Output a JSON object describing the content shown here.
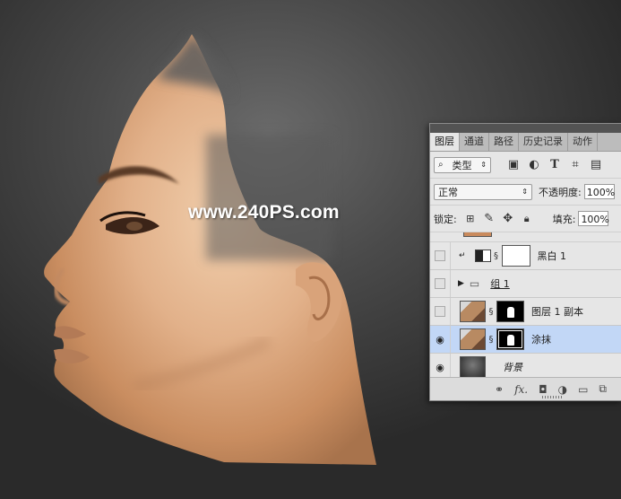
{
  "watermark": "www.240PS.com",
  "panel": {
    "tabs": [
      {
        "label": "图层",
        "active": true
      },
      {
        "label": "通道",
        "active": false
      },
      {
        "label": "路径",
        "active": false
      },
      {
        "label": "历史记录",
        "active": false
      },
      {
        "label": "动作",
        "active": false
      }
    ],
    "filter_kind": "类型",
    "blend_mode": "正常",
    "opacity_label": "不透明度:",
    "opacity_value": "100%",
    "lock_label": "锁定:",
    "fill_label": "填充:",
    "fill_value": "100%",
    "layers": [
      {
        "name": "黑白 1",
        "visible": false,
        "kind": "adjustment"
      },
      {
        "name": "组 1",
        "visible": false,
        "kind": "group"
      },
      {
        "name": "图层 1 副本",
        "visible": false,
        "kind": "masked"
      },
      {
        "name": "涂抹",
        "visible": true,
        "kind": "masked",
        "selected": true
      },
      {
        "name": "背景",
        "visible": true,
        "kind": "background"
      }
    ],
    "footer_icons": [
      "link-icon",
      "fx-icon",
      "mask-icon",
      "adjustment-icon",
      "folder-icon",
      "new-layer-icon"
    ],
    "footer_fx": "fx."
  },
  "colors": {
    "skin": "#e3b48c",
    "selected_row": "#c2d7f6"
  }
}
